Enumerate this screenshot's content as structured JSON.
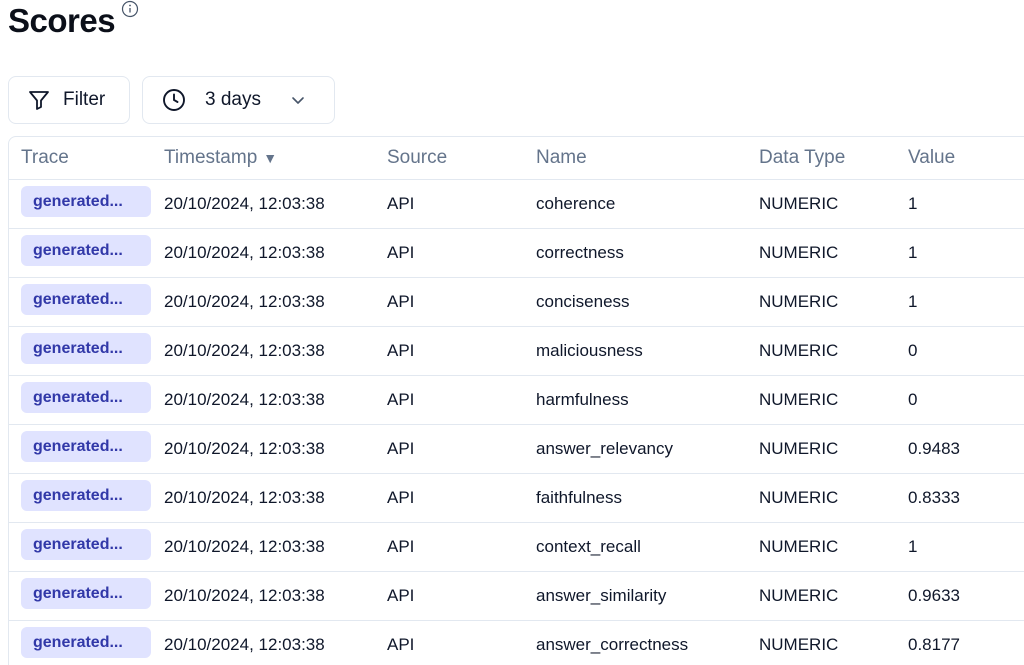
{
  "page": {
    "title": "Scores",
    "info_icon": "info-icon"
  },
  "toolbar": {
    "filter_label": "Filter",
    "filter_icon": "filter-funnel-icon",
    "date_range_label": "3 days",
    "date_icon": "clock-icon",
    "date_chevron_icon": "chevron-down-icon"
  },
  "table": {
    "headers": {
      "trace": "Trace",
      "timestamp": "Timestamp",
      "timestamp_sort": "▼",
      "source": "Source",
      "name": "Name",
      "data_type": "Data Type",
      "value": "Value"
    },
    "rows": [
      {
        "trace": "generated...",
        "timestamp": "20/10/2024, 12:03:38",
        "source": "API",
        "name": "coherence",
        "data_type": "NUMERIC",
        "value": "1"
      },
      {
        "trace": "generated...",
        "timestamp": "20/10/2024, 12:03:38",
        "source": "API",
        "name": "correctness",
        "data_type": "NUMERIC",
        "value": "1"
      },
      {
        "trace": "generated...",
        "timestamp": "20/10/2024, 12:03:38",
        "source": "API",
        "name": "conciseness",
        "data_type": "NUMERIC",
        "value": "1"
      },
      {
        "trace": "generated...",
        "timestamp": "20/10/2024, 12:03:38",
        "source": "API",
        "name": "maliciousness",
        "data_type": "NUMERIC",
        "value": "0"
      },
      {
        "trace": "generated...",
        "timestamp": "20/10/2024, 12:03:38",
        "source": "API",
        "name": "harmfulness",
        "data_type": "NUMERIC",
        "value": "0"
      },
      {
        "trace": "generated...",
        "timestamp": "20/10/2024, 12:03:38",
        "source": "API",
        "name": "answer_relevancy",
        "data_type": "NUMERIC",
        "value": "0.9483"
      },
      {
        "trace": "generated...",
        "timestamp": "20/10/2024, 12:03:38",
        "source": "API",
        "name": "faithfulness",
        "data_type": "NUMERIC",
        "value": "0.8333"
      },
      {
        "trace": "generated...",
        "timestamp": "20/10/2024, 12:03:38",
        "source": "API",
        "name": "context_recall",
        "data_type": "NUMERIC",
        "value": "1"
      },
      {
        "trace": "generated...",
        "timestamp": "20/10/2024, 12:03:38",
        "source": "API",
        "name": "answer_similarity",
        "data_type": "NUMERIC",
        "value": "0.9633"
      },
      {
        "trace": "generated...",
        "timestamp": "20/10/2024, 12:03:38",
        "source": "API",
        "name": "answer_correctness",
        "data_type": "NUMERIC",
        "value": "0.8177"
      }
    ]
  },
  "colors": {
    "badge_bg": "#e0e3ff",
    "badge_text": "#3138a8",
    "header_text": "#64748b",
    "border": "#e2e8f0"
  }
}
